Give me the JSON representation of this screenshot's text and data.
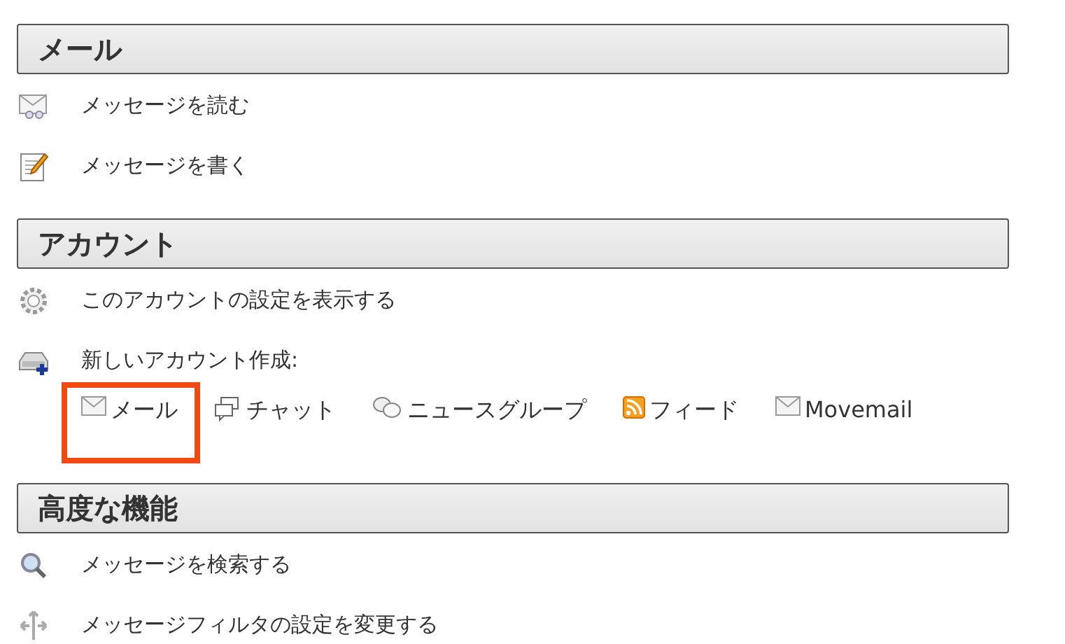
{
  "sections": [
    {
      "title": "メール",
      "items": [
        {
          "label": "メッセージを読む"
        },
        {
          "label": "メッセージを書く"
        }
      ]
    },
    {
      "title": "アカウント",
      "items": [
        {
          "label": "このアカウントの設定を表示する"
        },
        {
          "label": "新しいアカウント作成:",
          "account_types": [
            {
              "label": "メール",
              "highlighted": true
            },
            {
              "label": "チャット",
              "highlighted": false
            },
            {
              "label": "ニュースグループ",
              "highlighted": false
            },
            {
              "label": "フィード",
              "highlighted": false
            },
            {
              "label": "Movemail",
              "highlighted": false
            }
          ]
        }
      ]
    },
    {
      "title": "高度な機能",
      "items": [
        {
          "label": "メッセージを検索する"
        },
        {
          "label": "メッセージフィルタの設定を変更する"
        }
      ]
    }
  ]
}
